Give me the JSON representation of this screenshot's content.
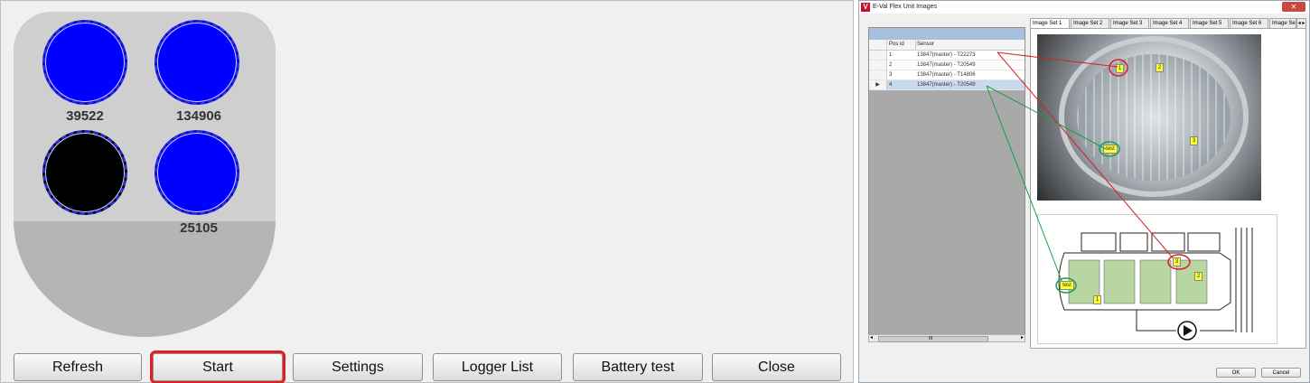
{
  "left": {
    "sensors": [
      {
        "label": "39522",
        "color": "#0000ff"
      },
      {
        "label": "134906",
        "color": "#0000ff"
      },
      {
        "label": "",
        "color": "#000000"
      },
      {
        "label": "25105",
        "color": "#0000ff"
      }
    ],
    "buttons": {
      "refresh": "Refresh",
      "start": "Start",
      "settings": "Settings",
      "logger_list": "Logger List",
      "battery_test": "Battery test",
      "close": "Close"
    },
    "active_button_outline": "#e02020"
  },
  "window": {
    "title": "E-Val Flex Unit Images",
    "icon_letter": "V",
    "close_glyph": "✕",
    "grid": {
      "columns": [
        "Pos id",
        "Sensor"
      ],
      "rows": [
        {
          "pos": "1",
          "sensor": "13847(master) - T22273"
        },
        {
          "pos": "2",
          "sensor": "13847(master) - T20549"
        },
        {
          "pos": "3",
          "sensor": "13847(master) - T14806"
        },
        {
          "pos": "4",
          "sensor": "13847(master) - T20549",
          "selected": true
        }
      ],
      "current_row_marker": "▶",
      "scroll_center": "III",
      "scroll_left": "◂",
      "scroll_right": "▸"
    },
    "tabs": [
      "Image Set 1",
      "Image Set 2",
      "Image Set 3",
      "Image Set 4",
      "Image Set 5",
      "Image Set 6",
      "Image Se"
    ],
    "tab_scroll": "◂ ▸",
    "photo_markers": [
      "1",
      "2",
      "3",
      "test"
    ],
    "diagram_markers": [
      "test",
      "1",
      "2",
      "3"
    ],
    "ok": "OK",
    "cancel": "Cancel",
    "line_colors": {
      "red": "#d62020",
      "green": "#1aa04a"
    }
  }
}
